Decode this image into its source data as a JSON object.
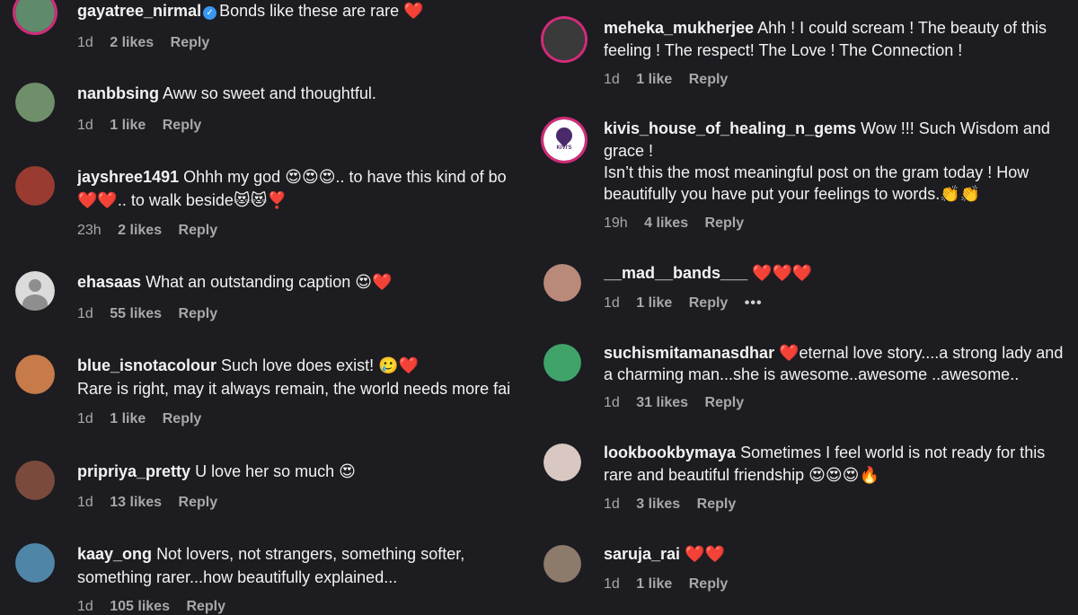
{
  "left": [
    {
      "user": "gayatree_nirmal",
      "verified": true,
      "text": "Bonds like these are rare ❤️",
      "time": "1d",
      "likes": "2 likes",
      "reply": "Reply",
      "avatar_color": "#5f8a6b"
    },
    {
      "user": "nanbbsing",
      "text": "Aww so sweet and thoughtful.",
      "time": "1d",
      "likes": "1 like",
      "reply": "Reply",
      "avatar_color": "#6f8f6a"
    },
    {
      "user": "jayshree1491",
      "text": "Ohhh my god 😍😍😍.. to have this kind of bo",
      "text2": "❤️❤️.. to walk beside😻😻❣️",
      "time": "23h",
      "likes": "2 likes",
      "reply": "Reply",
      "avatar_color": "#9a3b31"
    },
    {
      "user": "ehasaas",
      "text": "What an outstanding caption 😍❤️",
      "time": "1d",
      "likes": "55 likes",
      "reply": "Reply",
      "avatar_color": "#dbdbdb"
    },
    {
      "user": "blue_isnotacolour",
      "text": "Such love does exist! 🥲❤️",
      "text2": "Rare is right, may it always remain, the world needs more fai",
      "time": "1d",
      "likes": "1 like",
      "reply": "Reply",
      "avatar_color": "#c77a4a"
    },
    {
      "user": "pripriya_pretty",
      "text": "U love her so much 😍",
      "time": "1d",
      "likes": "13 likes",
      "reply": "Reply",
      "avatar_color": "#7a4a3d"
    },
    {
      "user": "kaay_ong",
      "text": "Not lovers, not strangers, something softer,",
      "text2": "something rarer...how beautifully explained...",
      "time": "1d",
      "likes": "105 likes",
      "reply": "Reply",
      "avatar_color": "#4f86a8"
    }
  ],
  "right": [
    {
      "user": "meheka_mukherjee",
      "text": "Ahh ! I could scream ! The beauty of this",
      "text2": "feeling ! The respect! The Love ! The Connection !",
      "time": "1d",
      "likes": "1 like",
      "reply": "Reply",
      "avatar_color": "#3a3a3a"
    },
    {
      "user": "kivis_house_of_healing_n_gems",
      "text": "Wow !!! Such Wisdom and",
      "text2": "grace !",
      "text3": "Isn’t this the most meaningful post on the gram today ! How",
      "text4": "beautifully you have put your feelings to words.👏👏",
      "time": "19h",
      "likes": "4 likes",
      "reply": "Reply",
      "avatar_color": "#ffffff",
      "avatar_label": "KIVI'S"
    },
    {
      "user": "__mad__bands___",
      "text": "❤️❤️❤️",
      "time": "1d",
      "likes": "1 like",
      "reply": "Reply",
      "more": "•••",
      "avatar_color": "#b98a7a"
    },
    {
      "user": "suchismitamanasdhar",
      "text": "❤️eternal love story....a strong lady and",
      "text2": "a charming man...she is awesome..awesome ..awesome..",
      "time": "1d",
      "likes": "31 likes",
      "reply": "Reply",
      "avatar_color": "#3fa36a"
    },
    {
      "user": "lookbookbymaya",
      "text": "Sometimes I feel world is not ready for this",
      "text2": "rare and beautiful friendship 😍😍😍🔥",
      "time": "1d",
      "likes": "3 likes",
      "reply": "Reply",
      "avatar_color": "#d9c7c2"
    },
    {
      "user": "saruja_rai",
      "text": "❤️❤️",
      "time": "1d",
      "likes": "1 like",
      "reply": "Reply",
      "avatar_color": "#8c7a6b"
    }
  ]
}
